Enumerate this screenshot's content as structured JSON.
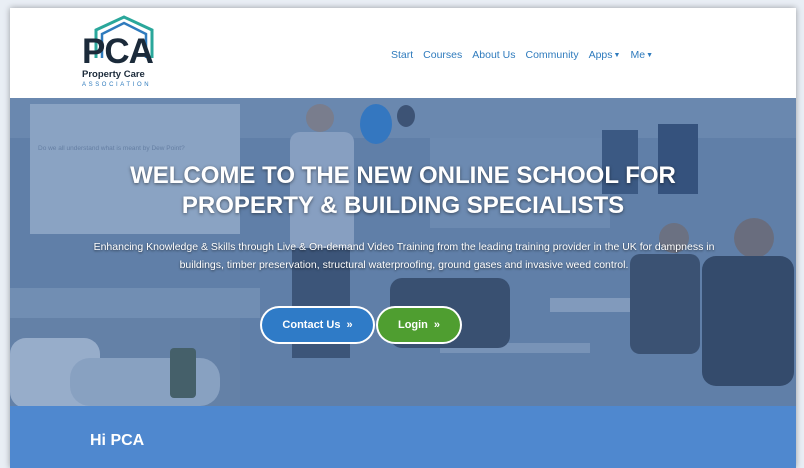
{
  "header": {
    "logo": {
      "main": "PCA",
      "line1": "Property Care",
      "line2": "ASSOCIATION"
    },
    "nav": [
      {
        "label": "Start",
        "dropdown": false
      },
      {
        "label": "Courses",
        "dropdown": false
      },
      {
        "label": "About Us",
        "dropdown": false
      },
      {
        "label": "Community",
        "dropdown": false
      },
      {
        "label": "Apps",
        "dropdown": true
      },
      {
        "label": "Me",
        "dropdown": true
      }
    ]
  },
  "hero": {
    "title_line1": "WELCOME TO THE NEW ONLINE SCHOOL FOR",
    "title_line2": "PROPERTY & BUILDING SPECIALISTS",
    "subtitle": "Enhancing Knowledge & Skills through Live & On-demand Video Training from the leading training provider in the UK for dampness in buildings, timber preservation, structural waterproofing, ground gases and invasive weed control.",
    "slide_text": "Do we all understand what is meant by Dew Point?",
    "contact_label": "Contact Us",
    "login_label": "Login"
  },
  "welcome": {
    "greeting": "Hi PCA"
  },
  "colors": {
    "brand_blue": "#2f7bbd",
    "brand_green": "#4f9e30",
    "band_blue": "#4f88cf",
    "logo_teal": "#2aa79b",
    "logo_dark": "#1b2a3a"
  },
  "icons": {
    "button_chevron": "double-chevron-right-icon",
    "nav_caret": "caret-down-icon"
  }
}
